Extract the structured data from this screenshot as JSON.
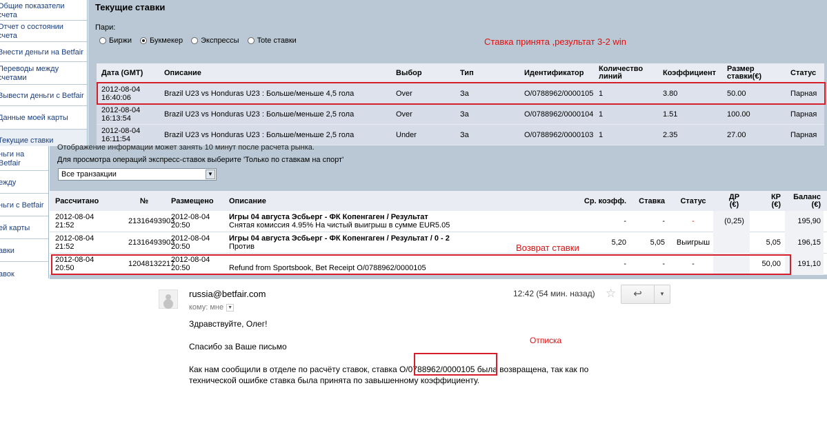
{
  "sidebar": {
    "items": [
      "Общие показатели\nсчета",
      "Отчет о состоянии\nсчета",
      "Внести деньги на Betfair",
      "Переводы между\nсчетами",
      "Вывести деньги с Betfair",
      "Данные моей карты",
      "Текущие ставки"
    ],
    "items_lower": [
      "ньги на Betfair",
      "ежду",
      "ньги с Betfair",
      "ей карты",
      "авки",
      "авок"
    ]
  },
  "top": {
    "title": "Текущие ставки",
    "pari_label": "Пари:",
    "radios": [
      {
        "label": "Биржи",
        "checked": false
      },
      {
        "label": "Букмекер",
        "checked": true
      },
      {
        "label": "Экспрессы",
        "checked": false
      },
      {
        "label": "Tote ставки",
        "checked": false
      }
    ],
    "annotation": "Ставка принята ,результат 3-2 win",
    "headers": [
      "Дата (GMT)",
      "Описание",
      "Выбор",
      "Тип",
      "Идентификатор",
      "Количество линий",
      "Коэффициент",
      "Размер ставки(€)",
      "Статус"
    ],
    "rows": [
      [
        "2012-08-04\n16:40:06",
        "Brazil U23 vs Honduras U23 : Больше/меньше 4,5 гола",
        "Over",
        "За",
        "O/0788962/0000105",
        "1",
        "3.80",
        "50.00",
        "Парная"
      ],
      [
        "2012-08-04\n16:13:54",
        "Brazil U23 vs Honduras U23 : Больше/меньше 2,5 гола",
        "Over",
        "За",
        "O/0788962/0000104",
        "1",
        "1.51",
        "100.00",
        "Парная"
      ],
      [
        "2012-08-04\n16:11:54",
        "Brazil U23 vs Honduras U23 : Больше/меньше 2,5 гола",
        "Under",
        "За",
        "O/0788962/0000103",
        "1",
        "2.35",
        "27.00",
        "Парная"
      ]
    ]
  },
  "mid": {
    "info1": "Отображение информации может занять 10 минут после расчета рынка.",
    "info2": "Для просмотра операций экспресс-ставок выберите 'Только по ставкам на спорт'",
    "select_value": "Все транзакции",
    "headers": [
      "Рассчитано",
      "№",
      "Размещено",
      "Описание",
      "Ср. коэфф.",
      "Ставка",
      "Статус",
      "ДР\n(€)",
      "КР\n(€)",
      "Баланс\n(€)"
    ],
    "rows": [
      {
        "calc": "2012-08-04\n21:52",
        "num": "21316493903",
        "placed": "2012-08-04\n20:50",
        "desc_bold": "Игры 04 августа Эсбьерг - ФК Копенгаген / Результат",
        "desc": "Снятая комиссия 4.95% На чистый выигрыш в сумме EUR5.05",
        "odds": "-",
        "stake": "-",
        "status": "-",
        "dr": "(0,25)",
        "kr": "",
        "balance": "195,90"
      },
      {
        "calc": "2012-08-04\n21:52",
        "num": "21316493903",
        "placed": "2012-08-04\n20:50",
        "desc_bold": "Игры 04 августа Эсбьерг - ФК Копенгаген / Результат / 0 - 2",
        "desc": "Против",
        "odds": "5,20",
        "stake": "5,05",
        "status": "Выигрыш",
        "dr": "",
        "kr": "5,05",
        "balance": "196,15"
      },
      {
        "calc": "2012-08-04\n20:50",
        "num": "12048132217",
        "placed": "2012-08-04\n20:50",
        "desc_bold": "",
        "desc": "Refund from Sportsbook, Bet Receipt O/0788962/0000105",
        "odds": "-",
        "stake": "-",
        "status": "-",
        "dr": "",
        "kr": "50,00",
        "balance": "191,10"
      }
    ],
    "annotation": "Возврат ставки"
  },
  "email": {
    "from": "russia@betfair.com",
    "to_label": "кому: мне",
    "time": "12:42 (54 мин. назад)",
    "greeting": "Здравствуйте, Олег!",
    "line2": "Спасибо за Ваше письмо",
    "line3_a": "Как нам сообщили в отделе по расчёту ставок, ставка ",
    "line3_id": "O/0788962/0000105",
    "line3_b": " была возвращена, так как по",
    "line4": "технической ошибке ставка была принята по завышенному коэффициенту.",
    "annotation": "Отписка"
  }
}
